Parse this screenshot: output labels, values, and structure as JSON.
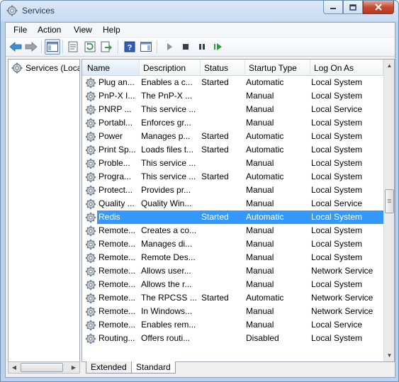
{
  "window": {
    "title": "Services"
  },
  "menu": [
    "File",
    "Edit",
    "View",
    "Help"
  ],
  "toolbar": [
    "back-icon",
    "forward-icon",
    "show-hide-console-tree-icon",
    "properties-icon",
    "refresh-icon",
    "export-list-icon",
    "help-icon",
    "show-hide-action-pane-icon",
    "start-service-icon",
    "stop-service-icon",
    "pause-service-icon",
    "restart-service-icon"
  ],
  "tree": {
    "root_label": "Services (Local)"
  },
  "columns": [
    "Name",
    "Description",
    "Status",
    "Startup Type",
    "Log On As"
  ],
  "sorted_column": "Name",
  "selected_row_index": 10,
  "rows": [
    {
      "name": "Plug an...",
      "description": "Enables a c...",
      "status": "Started",
      "startup": "Automatic",
      "logon": "Local System"
    },
    {
      "name": "PnP-X I...",
      "description": "The PnP-X ...",
      "status": "",
      "startup": "Manual",
      "logon": "Local System"
    },
    {
      "name": "PNRP ...",
      "description": "This service ...",
      "status": "",
      "startup": "Manual",
      "logon": "Local Service"
    },
    {
      "name": "Portabl...",
      "description": "Enforces gr...",
      "status": "",
      "startup": "Manual",
      "logon": "Local System"
    },
    {
      "name": "Power",
      "description": "Manages p...",
      "status": "Started",
      "startup": "Automatic",
      "logon": "Local System"
    },
    {
      "name": "Print Sp...",
      "description": "Loads files t...",
      "status": "Started",
      "startup": "Automatic",
      "logon": "Local System"
    },
    {
      "name": "Proble...",
      "description": "This service ...",
      "status": "",
      "startup": "Manual",
      "logon": "Local System"
    },
    {
      "name": "Progra...",
      "description": "This service ...",
      "status": "Started",
      "startup": "Automatic",
      "logon": "Local System"
    },
    {
      "name": "Protect...",
      "description": "Provides pr...",
      "status": "",
      "startup": "Manual",
      "logon": "Local System"
    },
    {
      "name": "Quality ...",
      "description": "Quality Win...",
      "status": "",
      "startup": "Manual",
      "logon": "Local Service"
    },
    {
      "name": "Redis",
      "description": "",
      "status": "Started",
      "startup": "Automatic",
      "logon": "Local System"
    },
    {
      "name": "Remote...",
      "description": "Creates a co...",
      "status": "",
      "startup": "Manual",
      "logon": "Local System"
    },
    {
      "name": "Remote...",
      "description": "Manages di...",
      "status": "",
      "startup": "Manual",
      "logon": "Local System"
    },
    {
      "name": "Remote...",
      "description": "Remote Des...",
      "status": "",
      "startup": "Manual",
      "logon": "Local System"
    },
    {
      "name": "Remote...",
      "description": "Allows user...",
      "status": "",
      "startup": "Manual",
      "logon": "Network Service"
    },
    {
      "name": "Remote...",
      "description": "Allows the r...",
      "status": "",
      "startup": "Manual",
      "logon": "Local System"
    },
    {
      "name": "Remote...",
      "description": "The RPCSS ...",
      "status": "Started",
      "startup": "Automatic",
      "logon": "Network Service"
    },
    {
      "name": "Remote...",
      "description": "In Windows...",
      "status": "",
      "startup": "Manual",
      "logon": "Network Service"
    },
    {
      "name": "Remote...",
      "description": "Enables rem...",
      "status": "",
      "startup": "Manual",
      "logon": "Local Service"
    },
    {
      "name": "Routing...",
      "description": "Offers routi...",
      "status": "",
      "startup": "Disabled",
      "logon": "Local System"
    }
  ],
  "tabs": [
    {
      "label": "Extended",
      "active": false
    },
    {
      "label": "Standard",
      "active": true
    }
  ]
}
